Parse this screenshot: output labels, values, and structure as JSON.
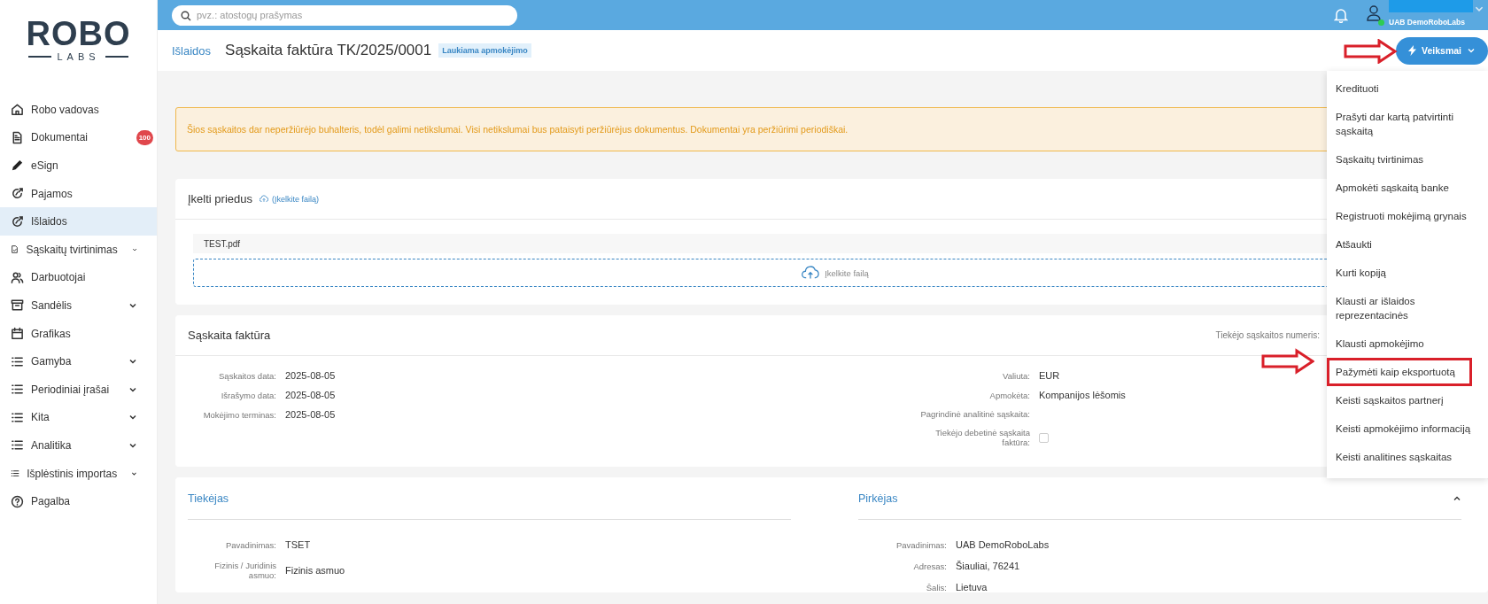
{
  "logo": {
    "top": "ROBO",
    "bottom": "LABS"
  },
  "sidebar": {
    "items": [
      {
        "label": "Robo vadovas",
        "kind": "home",
        "expandable": false,
        "selected": false
      },
      {
        "label": "Dokumentai",
        "kind": "document",
        "badge": "100",
        "expandable": false,
        "selected": false
      },
      {
        "label": "eSign",
        "kind": "pen",
        "expandable": false,
        "selected": false
      },
      {
        "label": "Pajamos",
        "kind": "coin",
        "expandable": false,
        "selected": false
      },
      {
        "label": "Išlaidos",
        "kind": "coin",
        "expandable": false,
        "selected": true
      },
      {
        "label": "Sąskaitų tvirtinimas",
        "kind": "checkdoc",
        "expandable": true,
        "selected": false
      },
      {
        "label": "Darbuotojai",
        "kind": "people",
        "expandable": false,
        "selected": false
      },
      {
        "label": "Sandėlis",
        "kind": "box",
        "expandable": true,
        "selected": false
      },
      {
        "label": "Grafikas",
        "kind": "calendar",
        "expandable": false,
        "selected": false
      },
      {
        "label": "Gamyba",
        "kind": "list",
        "expandable": true,
        "selected": false
      },
      {
        "label": "Periodiniai įrašai",
        "kind": "list",
        "expandable": true,
        "selected": false
      },
      {
        "label": "Kita",
        "kind": "list",
        "expandable": true,
        "selected": false
      },
      {
        "label": "Analitika",
        "kind": "list",
        "expandable": true,
        "selected": false
      },
      {
        "label": "Išplėstinis importas",
        "kind": "list",
        "expandable": true,
        "selected": false
      },
      {
        "label": "Pagalba",
        "kind": "help",
        "expandable": false,
        "selected": false
      }
    ]
  },
  "search": {
    "placeholder": "pvz.: atostogų prašymas"
  },
  "user": {
    "company": "UAB DemoRoboLabs",
    "online": true
  },
  "breadcrumb": "Išlaidos",
  "title": "Sąskaita faktūra TK/2025/0001",
  "status": "Laukiama apmokėjimo",
  "actions_button": "Veiksmai",
  "actions_menu": [
    {
      "label": "Kredituoti",
      "highlighted": false
    },
    {
      "label": "Prašyti dar kartą patvirtinti sąskaitą",
      "highlighted": false
    },
    {
      "label": "Sąskaitų tvirtinimas",
      "highlighted": false
    },
    {
      "label": "Apmokėti sąskaitą banke",
      "highlighted": false
    },
    {
      "label": "Registruoti mokėjimą grynais",
      "highlighted": false
    },
    {
      "label": "Atšaukti",
      "highlighted": false
    },
    {
      "label": "Kurti kopiją",
      "highlighted": false
    },
    {
      "label": "Klausti ar išlaidos reprezentacinės",
      "highlighted": false
    },
    {
      "label": "Klausti apmokėjimo",
      "highlighted": false
    },
    {
      "label": "Pažymėti kaip eksportuotą",
      "highlighted": true
    },
    {
      "label": "Keisti sąskaitos partnerį",
      "highlighted": false
    },
    {
      "label": "Keisti apmokėjimo informaciją",
      "highlighted": false
    },
    {
      "label": "Keisti analitines sąskaitas",
      "highlighted": false
    }
  ],
  "notice": "Šios sąskaitos dar neperžiūrėjo buhalteris, todėl galimi netikslumai. Visi netikslumai bus pataisyti peržiūrėjus dokumentus. Dokumentai yra peržiūrimi periodiškai.",
  "attachments": {
    "title": "Įkelti priedus",
    "upload_link": "(Įkelkite failą)",
    "file": "TEST.pdf",
    "dropzone": "Įkelkite failą"
  },
  "invoice": {
    "title": "Sąskaita faktūra",
    "supplier_number_label": "Tiekėjo sąskaitos numeris:",
    "left": [
      {
        "label": "Sąskaitos data:",
        "value": "2025-08-05"
      },
      {
        "label": "Išrašymo data:",
        "value": "2025-08-05"
      },
      {
        "label": "Mokėjimo terminas:",
        "value": "2025-08-05"
      }
    ],
    "right": [
      {
        "kind": "text",
        "label": "Valiuta:",
        "value": "EUR"
      },
      {
        "kind": "text",
        "label": "Apmokėta:",
        "value": "Kompanijos lėšomis"
      },
      {
        "kind": "text",
        "label": "Pagrindinė analitinė sąskaita:"
      },
      {
        "kind": "checkbox",
        "label": "Tiekėjo debetinė sąskaita faktūra:",
        "checked": false
      }
    ]
  },
  "parties": [
    {
      "title": "Tiekėjas",
      "collapsible": false,
      "fields": [
        {
          "label": "Pavadinimas:",
          "value": "TSET"
        },
        {
          "label": "Fizinis / Juridinis asmuo:",
          "value": "Fizinis asmuo"
        }
      ]
    },
    {
      "title": "Pirkėjas",
      "collapsible": true,
      "fields": [
        {
          "label": "Pavadinimas:",
          "value": "UAB DemoRoboLabs"
        },
        {
          "label": "Adresas:",
          "value": "Šiauliai, 76241"
        },
        {
          "label": "Šalis:",
          "value": "Lietuva"
        }
      ]
    }
  ]
}
